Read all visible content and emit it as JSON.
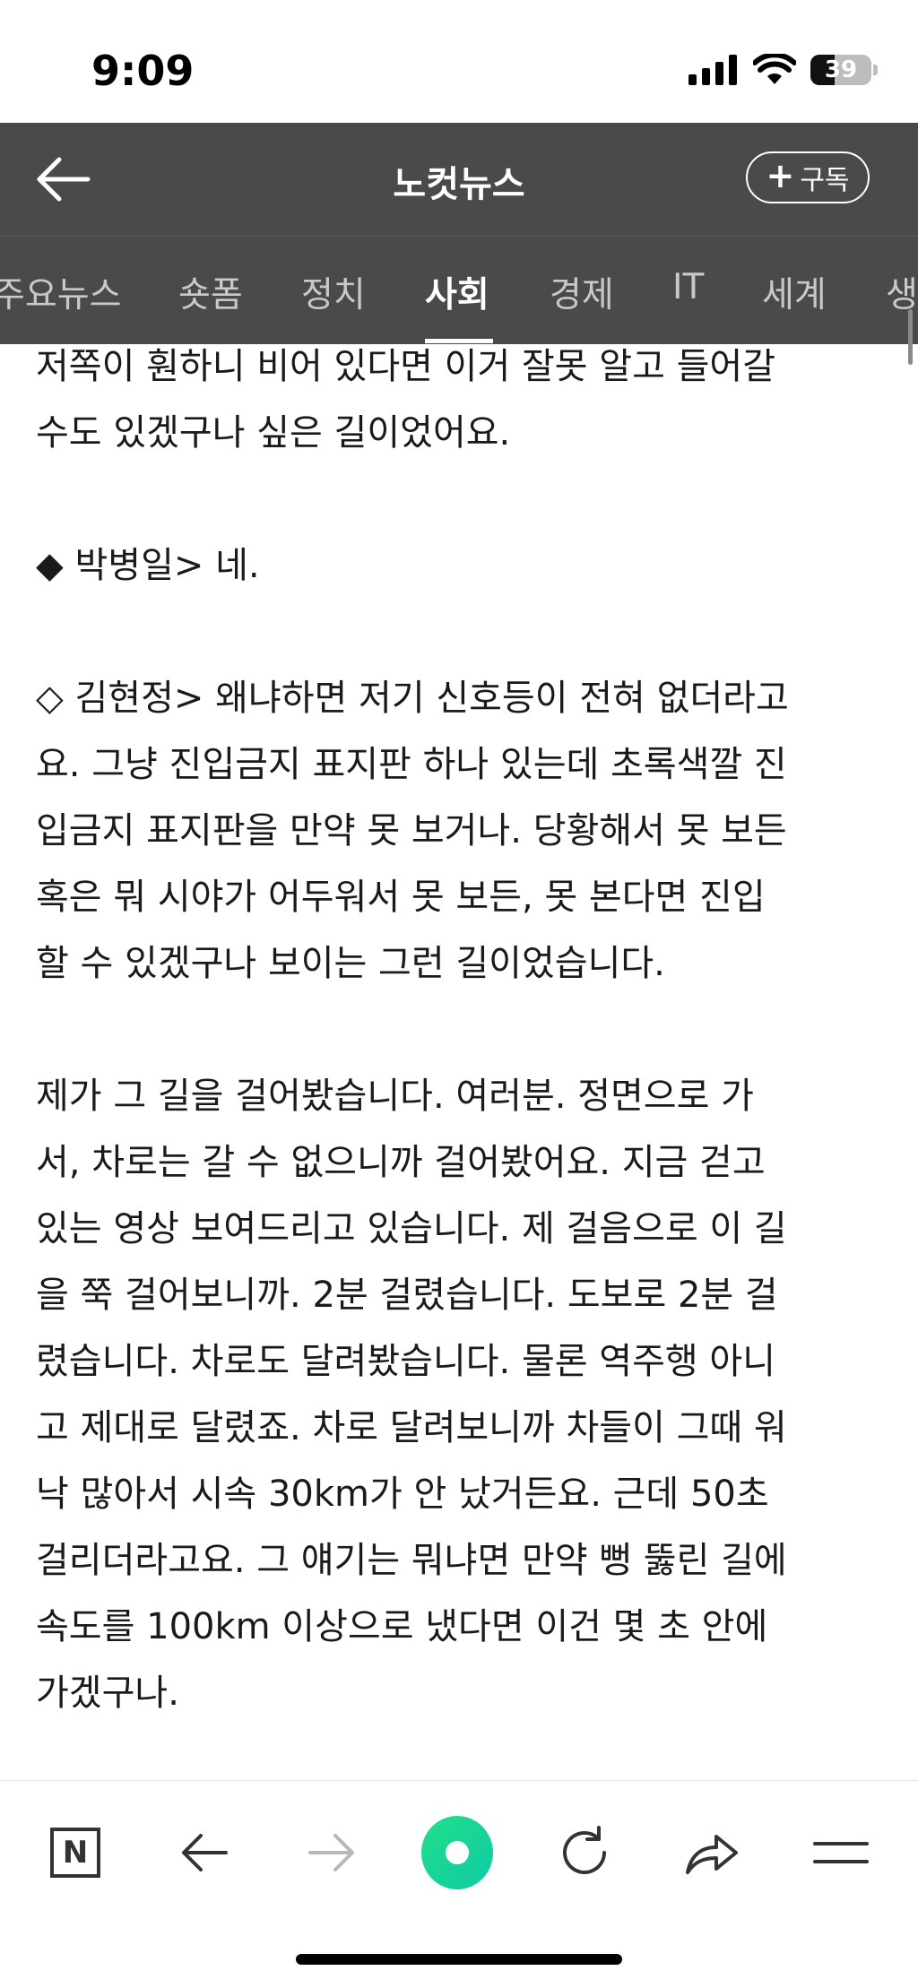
{
  "status": {
    "time": "9:09",
    "battery": "39",
    "battery_level": 0.39
  },
  "header": {
    "title": "노컷뉴스",
    "subscribe_plus": "+",
    "subscribe_label": "구독"
  },
  "tabs": [
    {
      "label": "주요뉴스"
    },
    {
      "label": "숏폼"
    },
    {
      "label": "정치"
    },
    {
      "label": "사회"
    },
    {
      "label": "경제"
    },
    {
      "label": "IT"
    },
    {
      "label": "세계"
    },
    {
      "label": "생"
    }
  ],
  "active_tab": "사회",
  "article": {
    "lines": [
      "저쪽이 훤하니 비어 있다면 이거 잘못 알고 들어갈",
      "수도 있겠구나 싶은 길이었어요.",
      "",
      "◆ 박병일> 네.",
      "",
      "◇ 김현정> 왜냐하면 저기 신호등이 전혀 없더라고",
      "요. 그냥 진입금지 표지판 하나 있는데 초록색깔 진",
      "입금지 표지판을 만약 못 보거나. 당황해서 못 보든",
      "혹은 뭐 시야가 어두워서 못 보든, 못 본다면 진입",
      "할 수 있겠구나 보이는 그런 길이었습니다.",
      "",
      "제가 그 길을 걸어봤습니다. 여러분. 정면으로 가",
      "서, 차로는 갈 수 없으니까 걸어봤어요. 지금 걷고",
      "있는 영상 보여드리고 있습니다. 제 걸음으로 이 길",
      "을 쭉 걸어보니까. 2분 걸렸습니다. 도보로 2분 걸",
      "렸습니다. 차로도 달려봤습니다. 물론 역주행 아니",
      "고 제대로 달렸죠. 차로 달려보니까 차들이 그때 워",
      "낙 많아서 시속 30km가 안 났거든요. 근데 50초",
      "걸리더라고요. 그 얘기는 뭐냐면 만약 뻥 뚫린 길에",
      "속도를 100km 이상으로 냈다면 이건 몇 초 안에",
      "가겠구나."
    ]
  },
  "toolbar": {
    "home_label": "N"
  },
  "icons": {
    "header_back": "arrow-left-icon",
    "toolbar": [
      "naver-n-icon",
      "arrow-left-icon",
      "arrow-right-icon",
      "green-dot-icon",
      "refresh-icon",
      "share-icon",
      "menu-icon"
    ]
  },
  "colors": {
    "header_bg": "#4a4a4b",
    "tab_inactive": "#c9c9c9",
    "accent_green": "#1fe08a"
  }
}
